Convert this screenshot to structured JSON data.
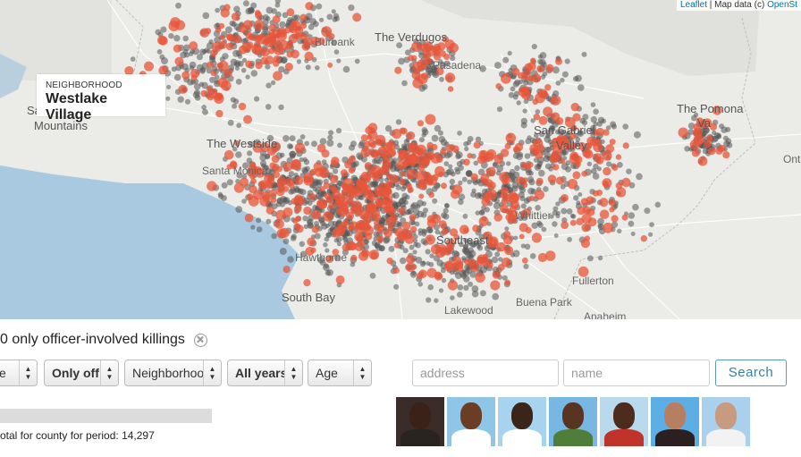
{
  "map": {
    "attribution": {
      "leaflet": "Leaflet",
      "sep": " | Map data (c) ",
      "osm": "OpenSt"
    },
    "neighborhood_box": {
      "label": "NEIGHBORHOOD",
      "name": "Westlake Village"
    },
    "place_labels": [
      "The Verdugos",
      "Pasadena",
      "Burbank",
      "The Westside",
      "Santa Monica",
      "Mountains",
      "Sa",
      "The Pomona",
      "Va",
      "Onta",
      "San Gabriel",
      "Valley",
      "Whittier",
      "Southeast",
      "Fullerton",
      "Buena Park",
      "Anaheim",
      "South Bay",
      "Lakewood",
      "Hawthorne"
    ],
    "colors": {
      "land": "#ebebe8",
      "water": "#a9c9e0",
      "dot_gray": "#555555",
      "dot_red": "#e8553a"
    }
  },
  "filter": {
    "text": "0 only officer-involved killings",
    "clear_icon": "close-circle-icon"
  },
  "selects": [
    {
      "id": "race",
      "value": "e"
    },
    {
      "id": "cause",
      "value": "Only off"
    },
    {
      "id": "neighborhood",
      "value": "Neighborhoo"
    },
    {
      "id": "year",
      "value": "All years"
    },
    {
      "id": "age",
      "value": "Age"
    }
  ],
  "search": {
    "address_placeholder": "address",
    "name_placeholder": "name",
    "button": "Search"
  },
  "summary": {
    "total_text": "otal for county for period: 14,297",
    "bar_fraction": 0.0
  },
  "photos": [
    {
      "bg": "#3a2c28",
      "skin": "#3b2219",
      "shirt": "#2a2420"
    },
    {
      "bg": "#8fc6e8",
      "skin": "#6b3d25",
      "shirt": "#ffffff"
    },
    {
      "bg": "#a8d3ee",
      "skin": "#3b2418",
      "shirt": "#ffffff"
    },
    {
      "bg": "#78b7e2",
      "skin": "#5a3422",
      "shirt": "#4f7d3a"
    },
    {
      "bg": "#b9d9ec",
      "skin": "#4d2c1d",
      "shirt": "#c0332a"
    },
    {
      "bg": "#5eaee6",
      "skin": "#b77f62",
      "shirt": "#2b1f22"
    },
    {
      "bg": "#a9d0ec",
      "skin": "#c89a80",
      "shirt": "#f2f2f2"
    }
  ]
}
